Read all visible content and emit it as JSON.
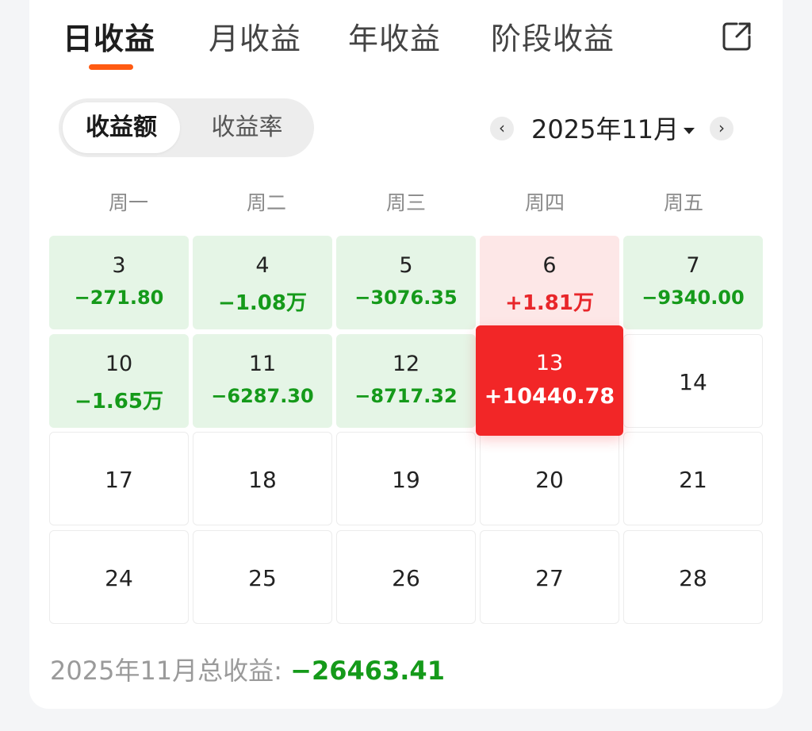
{
  "tabs": [
    {
      "label": "日收益",
      "active": true
    },
    {
      "label": "月收益",
      "active": false
    },
    {
      "label": "年收益",
      "active": false
    },
    {
      "label": "阶段收益",
      "active": false
    }
  ],
  "segment": {
    "options": [
      "收益额",
      "收益率"
    ],
    "selected": 0
  },
  "month_nav": {
    "prev": "‹",
    "label": "2025年11月",
    "next": "›"
  },
  "weekdays": [
    "周一",
    "周二",
    "周三",
    "周四",
    "周五"
  ],
  "weeks": [
    [
      {
        "day": "3",
        "value": "−271.80",
        "state": "neg"
      },
      {
        "day": "4",
        "value": "−1.08万",
        "state": "neg"
      },
      {
        "day": "5",
        "value": "−3076.35",
        "state": "neg"
      },
      {
        "day": "6",
        "value": "+1.81万",
        "state": "pos"
      },
      {
        "day": "7",
        "value": "−9340.00",
        "state": "neg"
      }
    ],
    [
      {
        "day": "10",
        "value": "−1.65万",
        "state": "neg"
      },
      {
        "day": "11",
        "value": "−6287.30",
        "state": "neg"
      },
      {
        "day": "12",
        "value": "−8717.32",
        "state": "neg"
      },
      {
        "day": "13",
        "value": "+10440.78",
        "state": "selected"
      },
      {
        "day": "14",
        "value": "",
        "state": "empty"
      }
    ],
    [
      {
        "day": "17",
        "value": "",
        "state": "empty"
      },
      {
        "day": "18",
        "value": "",
        "state": "empty"
      },
      {
        "day": "19",
        "value": "",
        "state": "empty"
      },
      {
        "day": "20",
        "value": "",
        "state": "empty"
      },
      {
        "day": "21",
        "value": "",
        "state": "empty"
      }
    ],
    [
      {
        "day": "24",
        "value": "",
        "state": "empty"
      },
      {
        "day": "25",
        "value": "",
        "state": "empty"
      },
      {
        "day": "26",
        "value": "",
        "state": "empty"
      },
      {
        "day": "27",
        "value": "",
        "state": "empty"
      },
      {
        "day": "28",
        "value": "",
        "state": "empty"
      }
    ]
  ],
  "total": {
    "label": "2025年11月总收益:",
    "value": "−26463.41"
  },
  "colors": {
    "accent": "#ff5a12",
    "loss": "#159a1a",
    "gain": "#e8262a",
    "selected": "#f22627"
  },
  "icons": {
    "share": "share-icon"
  }
}
